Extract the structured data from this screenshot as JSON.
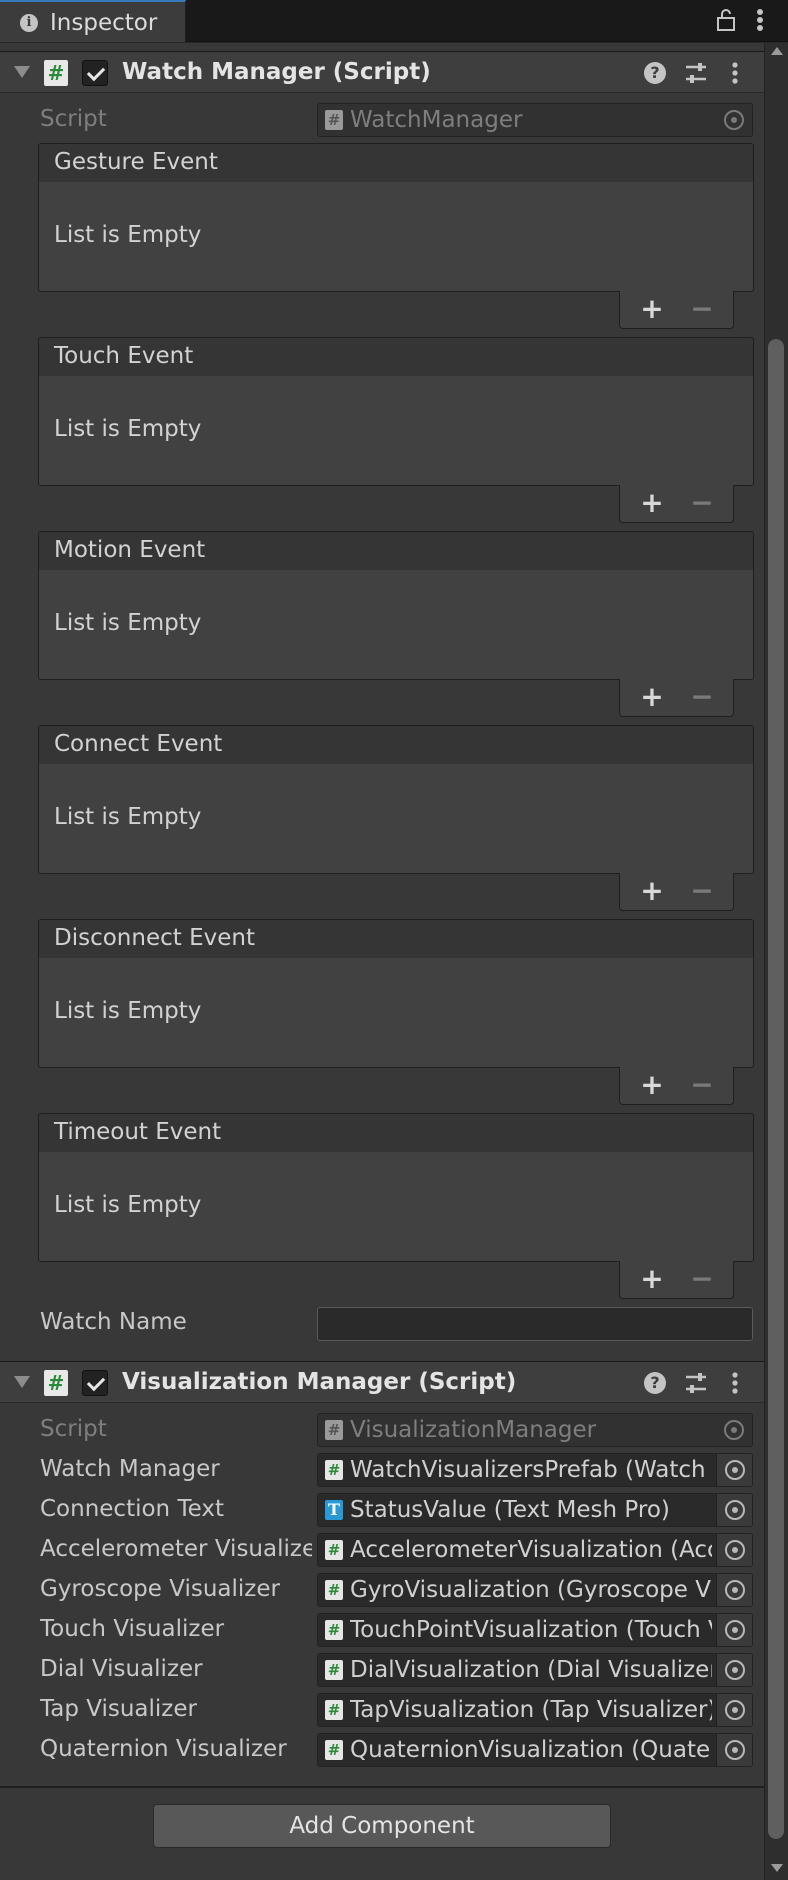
{
  "tab": {
    "label": "Inspector"
  },
  "watch_manager": {
    "title": "Watch Manager (Script)",
    "script_label": "Script",
    "script_value": "WatchManager",
    "events": [
      {
        "label": "Gesture Event",
        "empty_text": "List is Empty"
      },
      {
        "label": "Touch Event",
        "empty_text": "List is Empty"
      },
      {
        "label": "Motion Event",
        "empty_text": "List is Empty"
      },
      {
        "label": "Connect Event",
        "empty_text": "List is Empty"
      },
      {
        "label": "Disconnect Event",
        "empty_text": "List is Empty"
      },
      {
        "label": "Timeout Event",
        "empty_text": "List is Empty"
      }
    ],
    "add_symbol": "+",
    "remove_symbol": "−",
    "watch_name_label": "Watch Name",
    "watch_name_value": ""
  },
  "visualization_manager": {
    "title": "Visualization Manager (Script)",
    "script_label": "Script",
    "script_value": "VisualizationManager",
    "fields": [
      {
        "label": "Watch Manager",
        "value": "WatchVisualizersPrefab (Watch Manager)",
        "icon": "script-icon"
      },
      {
        "label": "Connection Text",
        "value": "StatusValue (Text Mesh Pro)",
        "icon": "text-mesh-pro-icon"
      },
      {
        "label": "Accelerometer Visualizer",
        "value": "AccelerometerVisualization (Accelerometer Visualizer)",
        "icon": "script-icon"
      },
      {
        "label": "Gyroscope Visualizer",
        "value": "GyroVisualization (Gyroscope Visualizer)",
        "icon": "script-icon"
      },
      {
        "label": "Touch Visualizer",
        "value": "TouchPointVisualization (Touch Visualizer)",
        "icon": "script-icon"
      },
      {
        "label": "Dial Visualizer",
        "value": "DialVisualization (Dial Visualizer)",
        "icon": "script-icon"
      },
      {
        "label": "Tap Visualizer",
        "value": "TapVisualization (Tap Visualizer)",
        "icon": "script-icon"
      },
      {
        "label": "Quaternion Visualizer",
        "value": "QuaternionVisualization (Quaternion Visualizer)",
        "icon": "script-icon"
      }
    ]
  },
  "add_component_label": "Add Component"
}
